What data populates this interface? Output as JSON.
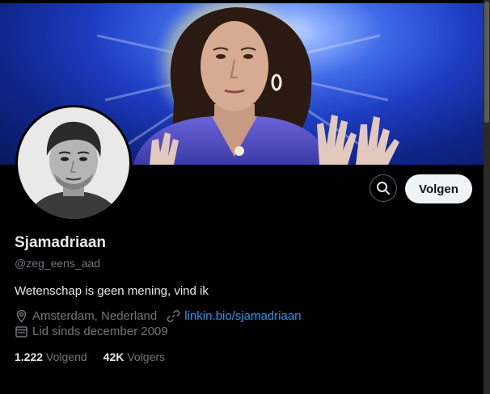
{
  "profile": {
    "display_name": "Sjamadriaan",
    "handle": "@zeg_eens_aad",
    "bio": "Wetenschap is geen mening, vind ik",
    "location": "Amsterdam, Nederland",
    "website": "linkin.bio/sjamadriaan",
    "joined": "Lid sinds december 2009"
  },
  "actions": {
    "follow_label": "Volgen",
    "search_icon": "search-icon"
  },
  "stats": {
    "following_count": "1.222",
    "following_label": "Volgend",
    "followers_count": "42K",
    "followers_label": "Volgers"
  },
  "colors": {
    "background": "#000000",
    "text_primary": "#e7e9ea",
    "text_secondary": "#71767b",
    "link": "#1d9bf0",
    "follow_button_bg": "#eff3f4"
  }
}
